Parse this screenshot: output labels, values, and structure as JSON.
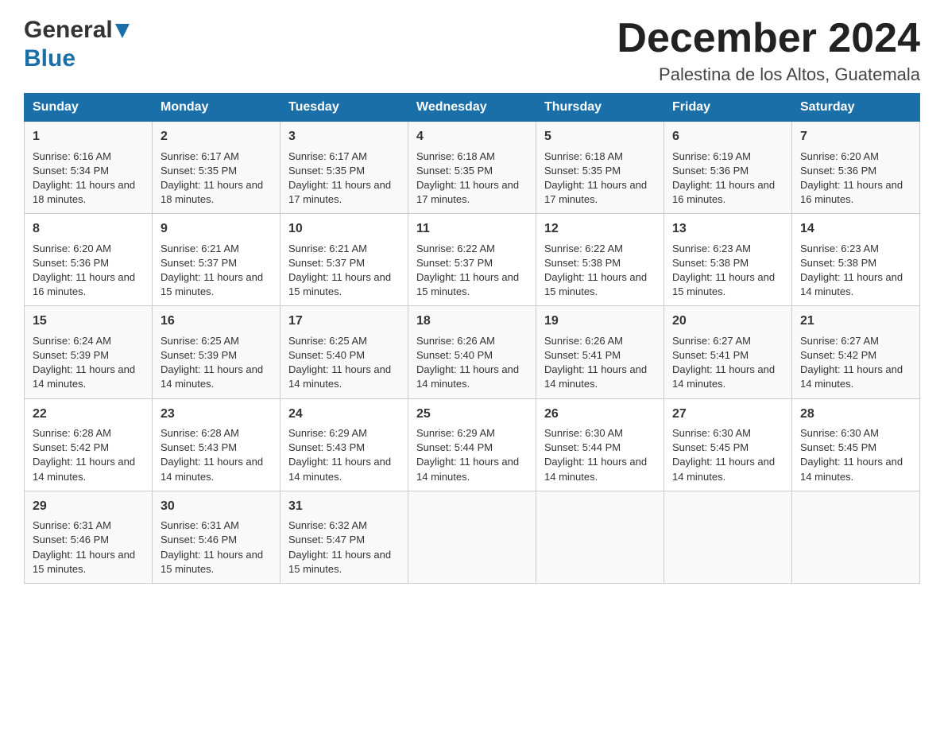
{
  "header": {
    "logo_line1": "General",
    "logo_line2": "Blue",
    "month_title": "December 2024",
    "location": "Palestina de los Altos, Guatemala"
  },
  "days_of_week": [
    "Sunday",
    "Monday",
    "Tuesday",
    "Wednesday",
    "Thursday",
    "Friday",
    "Saturday"
  ],
  "weeks": [
    [
      {
        "day": "1",
        "sunrise": "6:16 AM",
        "sunset": "5:34 PM",
        "daylight": "11 hours and 18 minutes."
      },
      {
        "day": "2",
        "sunrise": "6:17 AM",
        "sunset": "5:35 PM",
        "daylight": "11 hours and 18 minutes."
      },
      {
        "day": "3",
        "sunrise": "6:17 AM",
        "sunset": "5:35 PM",
        "daylight": "11 hours and 17 minutes."
      },
      {
        "day": "4",
        "sunrise": "6:18 AM",
        "sunset": "5:35 PM",
        "daylight": "11 hours and 17 minutes."
      },
      {
        "day": "5",
        "sunrise": "6:18 AM",
        "sunset": "5:35 PM",
        "daylight": "11 hours and 17 minutes."
      },
      {
        "day": "6",
        "sunrise": "6:19 AM",
        "sunset": "5:36 PM",
        "daylight": "11 hours and 16 minutes."
      },
      {
        "day": "7",
        "sunrise": "6:20 AM",
        "sunset": "5:36 PM",
        "daylight": "11 hours and 16 minutes."
      }
    ],
    [
      {
        "day": "8",
        "sunrise": "6:20 AM",
        "sunset": "5:36 PM",
        "daylight": "11 hours and 16 minutes."
      },
      {
        "day": "9",
        "sunrise": "6:21 AM",
        "sunset": "5:37 PM",
        "daylight": "11 hours and 15 minutes."
      },
      {
        "day": "10",
        "sunrise": "6:21 AM",
        "sunset": "5:37 PM",
        "daylight": "11 hours and 15 minutes."
      },
      {
        "day": "11",
        "sunrise": "6:22 AM",
        "sunset": "5:37 PM",
        "daylight": "11 hours and 15 minutes."
      },
      {
        "day": "12",
        "sunrise": "6:22 AM",
        "sunset": "5:38 PM",
        "daylight": "11 hours and 15 minutes."
      },
      {
        "day": "13",
        "sunrise": "6:23 AM",
        "sunset": "5:38 PM",
        "daylight": "11 hours and 15 minutes."
      },
      {
        "day": "14",
        "sunrise": "6:23 AM",
        "sunset": "5:38 PM",
        "daylight": "11 hours and 14 minutes."
      }
    ],
    [
      {
        "day": "15",
        "sunrise": "6:24 AM",
        "sunset": "5:39 PM",
        "daylight": "11 hours and 14 minutes."
      },
      {
        "day": "16",
        "sunrise": "6:25 AM",
        "sunset": "5:39 PM",
        "daylight": "11 hours and 14 minutes."
      },
      {
        "day": "17",
        "sunrise": "6:25 AM",
        "sunset": "5:40 PM",
        "daylight": "11 hours and 14 minutes."
      },
      {
        "day": "18",
        "sunrise": "6:26 AM",
        "sunset": "5:40 PM",
        "daylight": "11 hours and 14 minutes."
      },
      {
        "day": "19",
        "sunrise": "6:26 AM",
        "sunset": "5:41 PM",
        "daylight": "11 hours and 14 minutes."
      },
      {
        "day": "20",
        "sunrise": "6:27 AM",
        "sunset": "5:41 PM",
        "daylight": "11 hours and 14 minutes."
      },
      {
        "day": "21",
        "sunrise": "6:27 AM",
        "sunset": "5:42 PM",
        "daylight": "11 hours and 14 minutes."
      }
    ],
    [
      {
        "day": "22",
        "sunrise": "6:28 AM",
        "sunset": "5:42 PM",
        "daylight": "11 hours and 14 minutes."
      },
      {
        "day": "23",
        "sunrise": "6:28 AM",
        "sunset": "5:43 PM",
        "daylight": "11 hours and 14 minutes."
      },
      {
        "day": "24",
        "sunrise": "6:29 AM",
        "sunset": "5:43 PM",
        "daylight": "11 hours and 14 minutes."
      },
      {
        "day": "25",
        "sunrise": "6:29 AM",
        "sunset": "5:44 PM",
        "daylight": "11 hours and 14 minutes."
      },
      {
        "day": "26",
        "sunrise": "6:30 AM",
        "sunset": "5:44 PM",
        "daylight": "11 hours and 14 minutes."
      },
      {
        "day": "27",
        "sunrise": "6:30 AM",
        "sunset": "5:45 PM",
        "daylight": "11 hours and 14 minutes."
      },
      {
        "day": "28",
        "sunrise": "6:30 AM",
        "sunset": "5:45 PM",
        "daylight": "11 hours and 14 minutes."
      }
    ],
    [
      {
        "day": "29",
        "sunrise": "6:31 AM",
        "sunset": "5:46 PM",
        "daylight": "11 hours and 15 minutes."
      },
      {
        "day": "30",
        "sunrise": "6:31 AM",
        "sunset": "5:46 PM",
        "daylight": "11 hours and 15 minutes."
      },
      {
        "day": "31",
        "sunrise": "6:32 AM",
        "sunset": "5:47 PM",
        "daylight": "11 hours and 15 minutes."
      },
      null,
      null,
      null,
      null
    ]
  ],
  "labels": {
    "sunrise": "Sunrise:",
    "sunset": "Sunset:",
    "daylight": "Daylight:"
  }
}
